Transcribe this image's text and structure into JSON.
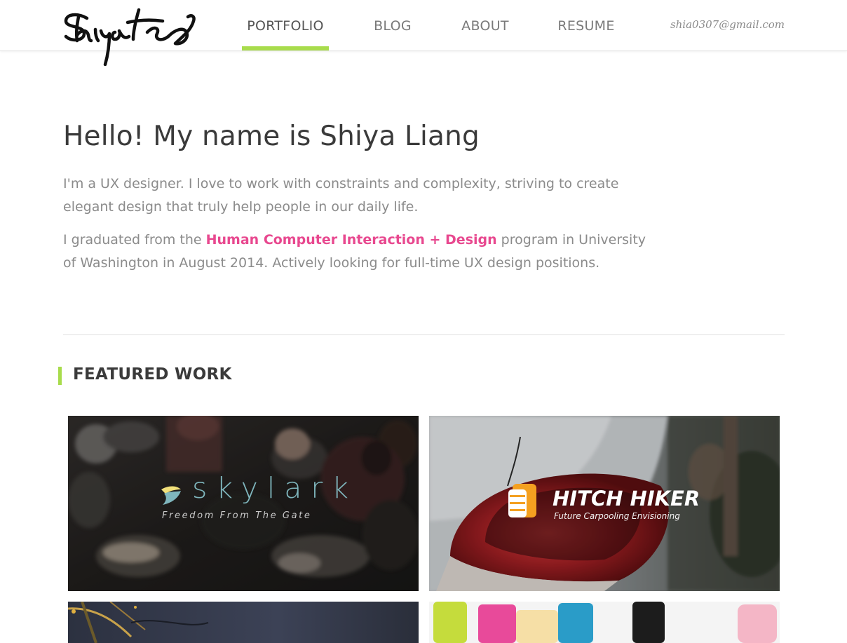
{
  "header": {
    "logo_text": "Shiya",
    "nav": [
      {
        "label": "PORTFOLIO",
        "active": true
      },
      {
        "label": "BLOG",
        "active": false
      },
      {
        "label": "ABOUT",
        "active": false
      },
      {
        "label": "RESUME",
        "active": false
      }
    ],
    "email": "shia0307@gmail.com"
  },
  "intro": {
    "title": "Hello! My name is Shiya Liang",
    "paragraph1": "I'm a UX designer. I love to work with constraints and complexity, striving to create elegant design that truly help people in our daily life.",
    "paragraph2_before": "I graduated from the ",
    "program_link": "Human Computer Interaction + Design",
    "paragraph2_after": " program in University of Washington in August 2014. Actively looking for full-time UX design positions."
  },
  "featured": {
    "title": "FEATURED WORK",
    "projects": [
      {
        "name": "skylark",
        "tagline": "Freedom From The Gate"
      },
      {
        "name": "HITCH HIKER",
        "tagline": "Future Carpooling Envisioning"
      }
    ]
  },
  "colors": {
    "accent_green": "#a8dc4c",
    "link_pink": "#e8488f",
    "skylark_teal": "#7fb6bd",
    "skylark_yellow": "#f2e07a",
    "hitch_orange": "#f4a020"
  },
  "icons": [
    "skylark-bird-icon",
    "hitch-hiker-thumb-icon"
  ]
}
